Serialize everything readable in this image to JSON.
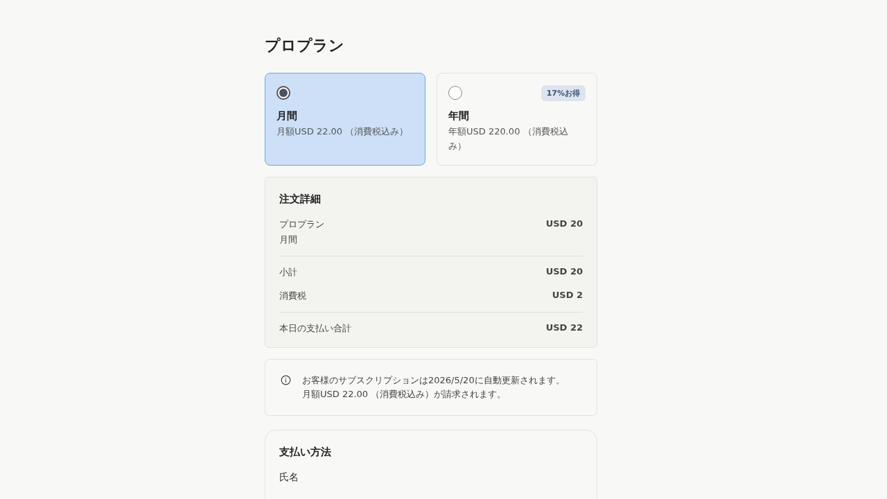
{
  "title": "プロプラン",
  "plans": [
    {
      "name": "月間",
      "price": "月額USD 22.00 （消費税込み）",
      "selected": true
    },
    {
      "name": "年間",
      "price": "年額USD 220.00 （消費税込み）",
      "badge": "17%お得",
      "selected": false
    }
  ],
  "order": {
    "title": "注文詳細",
    "groups": [
      [
        {
          "label": "プロプラン",
          "sublabel": "月間",
          "amount": "USD 20"
        }
      ],
      [
        {
          "label": "小計",
          "amount": "USD 20"
        },
        {
          "label": "消費税",
          "amount": "USD 2"
        }
      ],
      [
        {
          "label": "本日の支払い合計",
          "amount": "USD 22"
        }
      ]
    ]
  },
  "notice": "お客様のサブスクリプションは2026/5/20に自動更新されます。月額USD 22.00 （消費税込み）が請求されます。",
  "payment": {
    "title": "支払い方法",
    "fields": [
      {
        "label": "氏名"
      }
    ]
  }
}
